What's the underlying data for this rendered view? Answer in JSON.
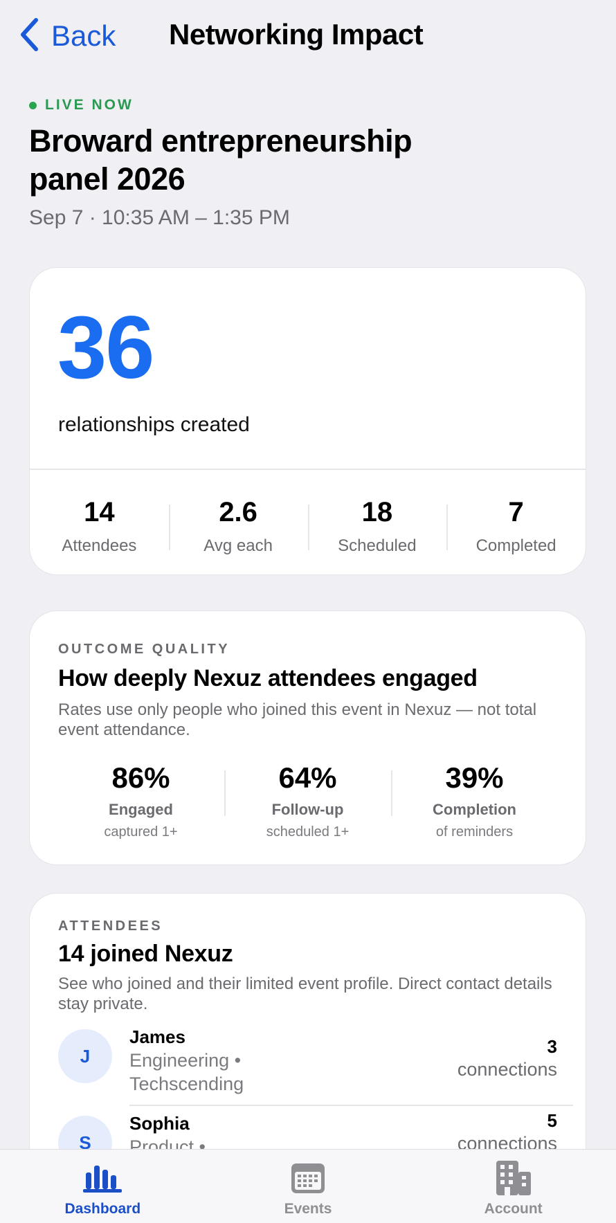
{
  "nav": {
    "back_label": "Back",
    "title": "Networking Impact"
  },
  "event": {
    "status": "LIVE NOW",
    "title": "Broward entrepreneurship panel 2026",
    "time": "Sep 7 · 10:35 AM – 1:35 PM"
  },
  "summary": {
    "value": "36",
    "label": "relationships created",
    "stats": [
      {
        "value": "14",
        "label": "Attendees"
      },
      {
        "value": "2.6",
        "label": "Avg each"
      },
      {
        "value": "18",
        "label": "Scheduled"
      },
      {
        "value": "7",
        "label": "Completed"
      }
    ]
  },
  "quality": {
    "overline": "OUTCOME QUALITY",
    "heading": "How deeply Nexuz attendees engaged",
    "description": "Rates use only people who joined this event in Nexuz — not total event attendance.",
    "rates": [
      {
        "value": "86%",
        "label": "Engaged",
        "sub": "captured 1+"
      },
      {
        "value": "64%",
        "label": "Follow-up",
        "sub": "scheduled 1+"
      },
      {
        "value": "39%",
        "label": "Completion",
        "sub": "of reminders"
      }
    ]
  },
  "attendees": {
    "overline": "ATTENDEES",
    "heading": "14 joined Nexuz",
    "description": "See who joined and their limited event profile. Direct contact details stay private.",
    "list": [
      {
        "initial": "J",
        "name": "James",
        "detail": "Engineering • Techscending",
        "count": "3",
        "count_label": "connections"
      },
      {
        "initial": "S",
        "name": "Sophia",
        "detail": "Product • InnovateFL",
        "count": "5",
        "count_label": "connections"
      }
    ]
  },
  "tabs": [
    {
      "label": "Dashboard",
      "icon": "bar-chart-icon",
      "active": true
    },
    {
      "label": "Events",
      "icon": "calendar-icon",
      "active": false
    },
    {
      "label": "Account",
      "icon": "building-icon",
      "active": false
    }
  ],
  "colors": {
    "accent": "#1a6cf0",
    "live": "#2a9a52",
    "background": "#efeff4"
  }
}
